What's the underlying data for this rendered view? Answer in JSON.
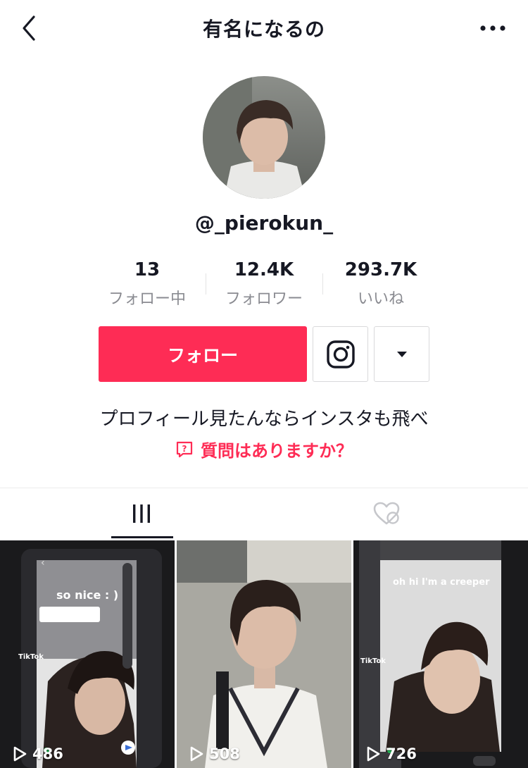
{
  "header": {
    "title": "有名になるの",
    "back_icon": "chevron-left-icon",
    "more_icon": "more-horizontal-icon"
  },
  "profile": {
    "username": "@_pierokun_",
    "bio": "プロフィール見たんならインスタも飛べ",
    "qa_link": "質問はありますか？"
  },
  "stats": [
    {
      "value": "13",
      "label": "フォロー中"
    },
    {
      "value": "12.4K",
      "label": "フォロワー"
    },
    {
      "value": "293.7K",
      "label": "いいね"
    }
  ],
  "actions": {
    "follow_label": "フォロー",
    "instagram_icon": "instagram-icon",
    "dropdown_icon": "caret-down-icon"
  },
  "tabs": [
    {
      "name": "videos",
      "icon": "grid-bars-icon",
      "active": true
    },
    {
      "name": "liked",
      "icon": "hidden-heart-icon",
      "active": false
    }
  ],
  "videos": [
    {
      "views": "486",
      "overlay_text": "so nice : )",
      "app_label": "TikTok"
    },
    {
      "views": "508"
    },
    {
      "views": "726",
      "overlay_text": "oh hi I'm a creeper",
      "app_label": "TikTok"
    }
  ],
  "colors": {
    "accent": "#fe2c55",
    "text": "#161823",
    "secondary_text": "#8a8b91"
  }
}
